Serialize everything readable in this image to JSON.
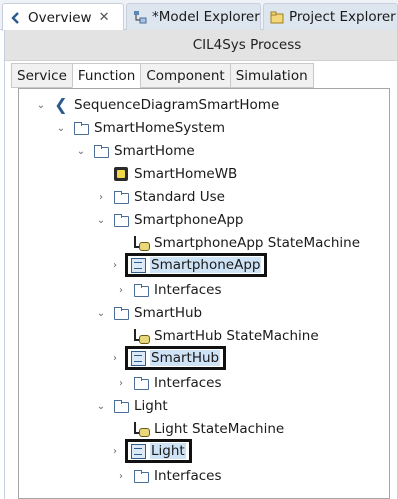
{
  "view_tabs": [
    {
      "label": "Overview",
      "close": "✕",
      "icon": "overview-icon"
    },
    {
      "label": "*Model Explorer",
      "icon": "model-explorer-icon"
    },
    {
      "label": "Project Explorer",
      "icon": "project-explorer-icon"
    }
  ],
  "panel": {
    "title": "CIL4Sys Process",
    "tabs": [
      "Service",
      "Function",
      "Component",
      "Simulation"
    ],
    "active_tab": "Function"
  },
  "tree": [
    {
      "label": "SequenceDiagramSmartHome",
      "icon": "model-icon",
      "expanded": true
    },
    {
      "label": "SmartHomeSystem",
      "icon": "folder-icon",
      "expanded": true
    },
    {
      "label": "SmartHome",
      "icon": "folder-icon",
      "expanded": true
    },
    {
      "label": "SmartHomeWB",
      "icon": "workbench-icon"
    },
    {
      "label": "Standard Use",
      "icon": "folder-icon",
      "expanded": false
    },
    {
      "label": "SmartphoneApp",
      "icon": "folder-icon",
      "expanded": true
    },
    {
      "label": "SmartphoneApp StateMachine",
      "icon": "state-machine-icon"
    },
    {
      "label": "SmartphoneApp",
      "icon": "block-icon",
      "expanded": false,
      "highlighted": true
    },
    {
      "label": "Interfaces",
      "icon": "folder-icon",
      "expanded": false
    },
    {
      "label": "SmartHub",
      "icon": "folder-icon",
      "expanded": true
    },
    {
      "label": "SmartHub StateMachine",
      "icon": "state-machine-icon"
    },
    {
      "label": "SmartHub",
      "icon": "block-icon",
      "expanded": false,
      "highlighted": true
    },
    {
      "label": "Interfaces",
      "icon": "folder-icon",
      "expanded": false
    },
    {
      "label": "Light",
      "icon": "folder-icon",
      "expanded": true
    },
    {
      "label": "Light StateMachine",
      "icon": "state-machine-icon"
    },
    {
      "label": "Light",
      "icon": "block-icon",
      "expanded": false,
      "highlighted": true
    },
    {
      "label": "Interfaces",
      "icon": "folder-icon",
      "expanded": false
    }
  ],
  "glyphs": {
    "expanded": "⌄",
    "collapsed": "›",
    "model": "❮"
  }
}
